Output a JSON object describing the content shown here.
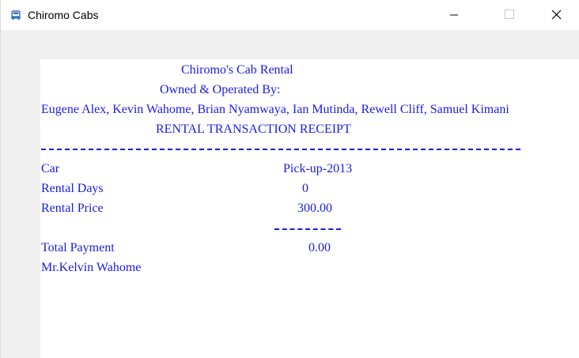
{
  "window": {
    "title": "Chiromo Cabs",
    "icon": "car-icon",
    "controls": {
      "minimize_icon": "minimize-icon",
      "maximize_icon": "maximize-icon",
      "close_icon": "close-icon"
    }
  },
  "receipt": {
    "company_name": "Chiromo's Cab Rental",
    "owned_by_label": "Owned & Operated By:",
    "owners": "Eugene Alex, Kevin Wahome, Brian Nyamwaya, Ian Mutinda, Rewell Cliff, Samuel Kimani",
    "heading": "RENTAL TRANSACTION RECEIPT",
    "rows": [
      {
        "label": "Car",
        "value": "Pick-up-2013"
      },
      {
        "label": "Rental Days",
        "value": "0"
      },
      {
        "label": "Rental Price",
        "value": "300.00"
      }
    ],
    "total_label": "Total Payment",
    "total_value": "0.00",
    "customer_name": "Mr.Kelvin Wahome"
  },
  "colors": {
    "receipt_text": "#1a1ae6",
    "background": "#f0f0f0",
    "paper": "#ffffff"
  }
}
